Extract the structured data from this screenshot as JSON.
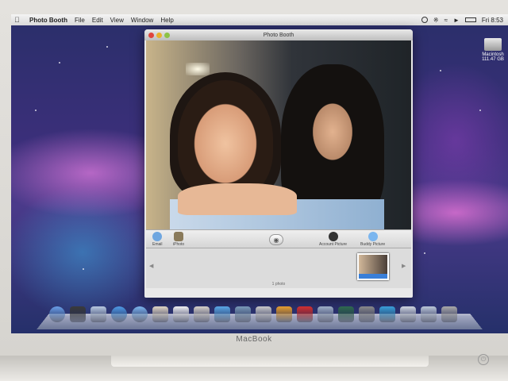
{
  "menubar": {
    "app_name": "Photo Booth",
    "items": [
      "File",
      "Edit",
      "View",
      "Window",
      "Help"
    ],
    "clock": "Fri 8:53"
  },
  "desktop": {
    "drive_name": "Macintosh",
    "drive_size": "111.47 GB"
  },
  "window": {
    "title": "Photo Booth",
    "toolbar": {
      "email_label": "Email",
      "iphoto_label": "iPhoto",
      "account_label": "Account Picture",
      "buddy_label": "Buddy Picture"
    },
    "strip_count_label": "1 photo"
  },
  "hardware": {
    "brand": "MacBook"
  },
  "dock": {
    "icons": [
      "finder-icon",
      "dashboard-icon",
      "mail-icon",
      "safari-icon",
      "ichat-icon",
      "address-book-icon",
      "ical-icon",
      "preview-icon",
      "itunes-icon",
      "iphoto-icon",
      "imovie-icon",
      "garageband-icon",
      "photo-booth-icon",
      "spaces-icon",
      "time-machine-icon",
      "system-preferences-icon",
      "network-icon",
      "documents-folder-icon",
      "downloads-folder-icon",
      "trash-icon"
    ]
  }
}
